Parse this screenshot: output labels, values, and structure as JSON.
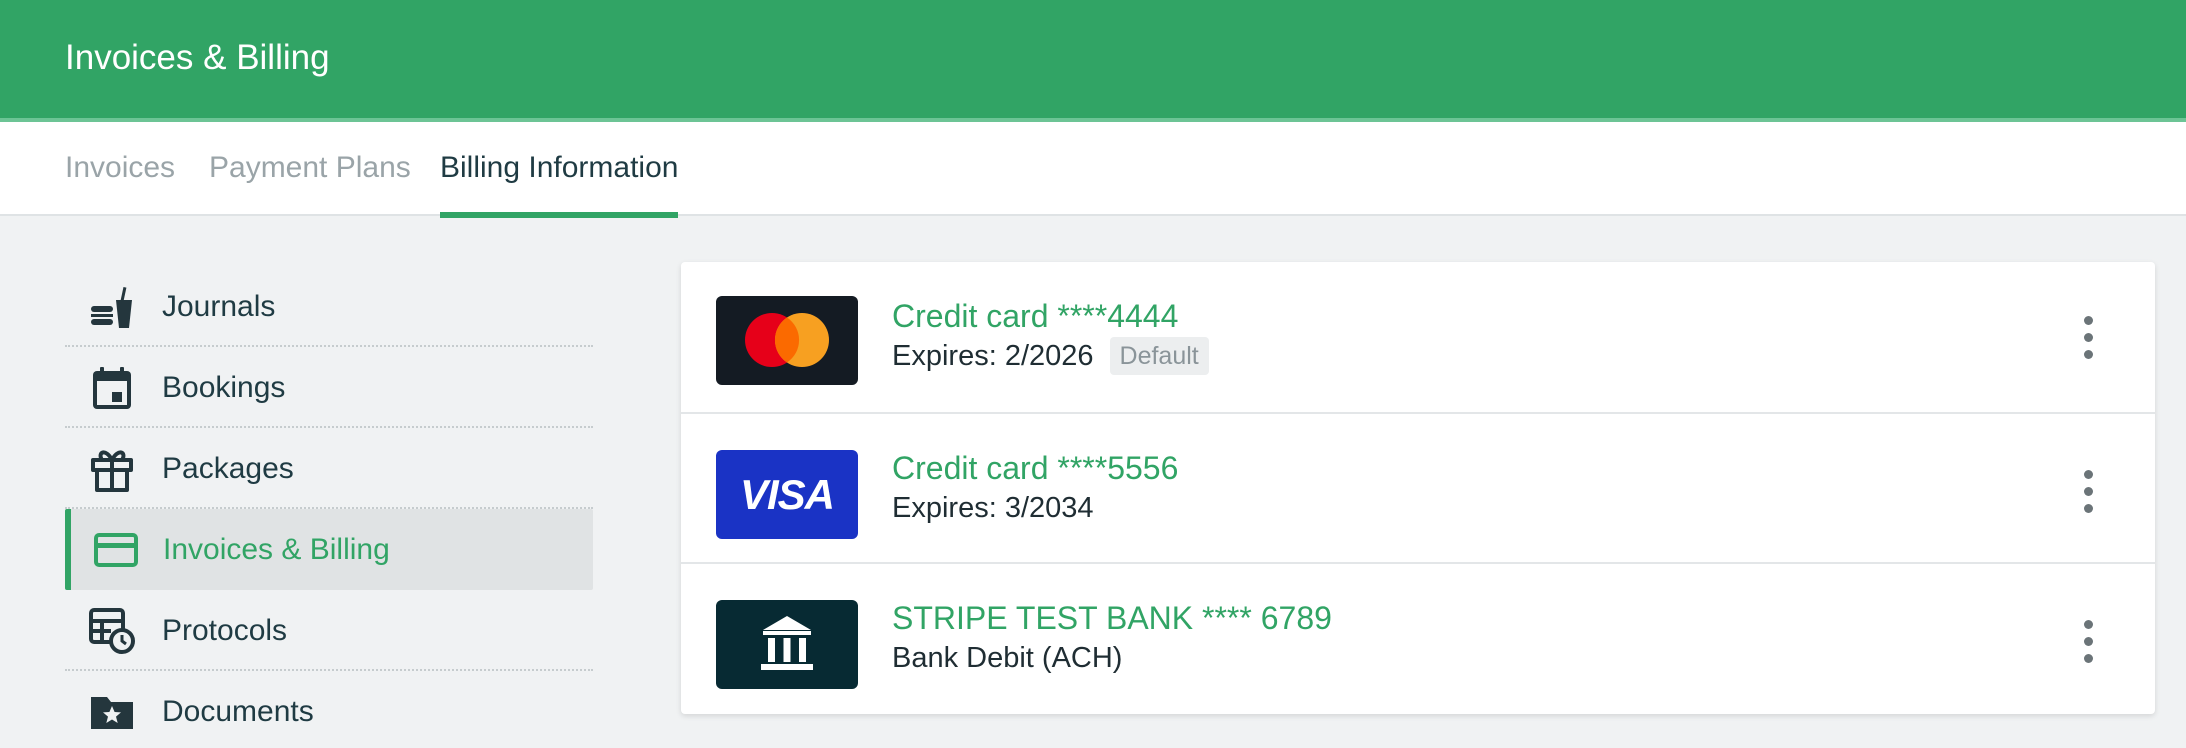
{
  "header": {
    "title": "Invoices & Billing"
  },
  "tabs": [
    {
      "label": "Invoices"
    },
    {
      "label": "Payment Plans"
    },
    {
      "label": "Billing Information"
    }
  ],
  "sidebar": {
    "items": [
      {
        "label": "Journals",
        "icon": "food-drink-icon"
      },
      {
        "label": "Bookings",
        "icon": "calendar-icon"
      },
      {
        "label": "Packages",
        "icon": "gift-icon"
      },
      {
        "label": "Invoices & Billing",
        "icon": "credit-card-icon"
      },
      {
        "label": "Protocols",
        "icon": "table-clock-icon"
      },
      {
        "label": "Documents",
        "icon": "folder-star-icon"
      }
    ]
  },
  "payment_methods": [
    {
      "name": "Credit card ****4444",
      "detail": "Expires: 2/2026",
      "badge": "Default",
      "brand": "mastercard"
    },
    {
      "name": "Credit card ****5556",
      "detail": "Expires: 3/2034",
      "brand": "visa",
      "brand_text": "VISA"
    },
    {
      "name": "STRIPE TEST BANK **** 6789",
      "detail": "Bank Debit (ACH)",
      "brand": "bank"
    }
  ],
  "colors": {
    "accent": "#31a465",
    "header_bg": "#31a465",
    "text_dark": "#1f3b43"
  }
}
